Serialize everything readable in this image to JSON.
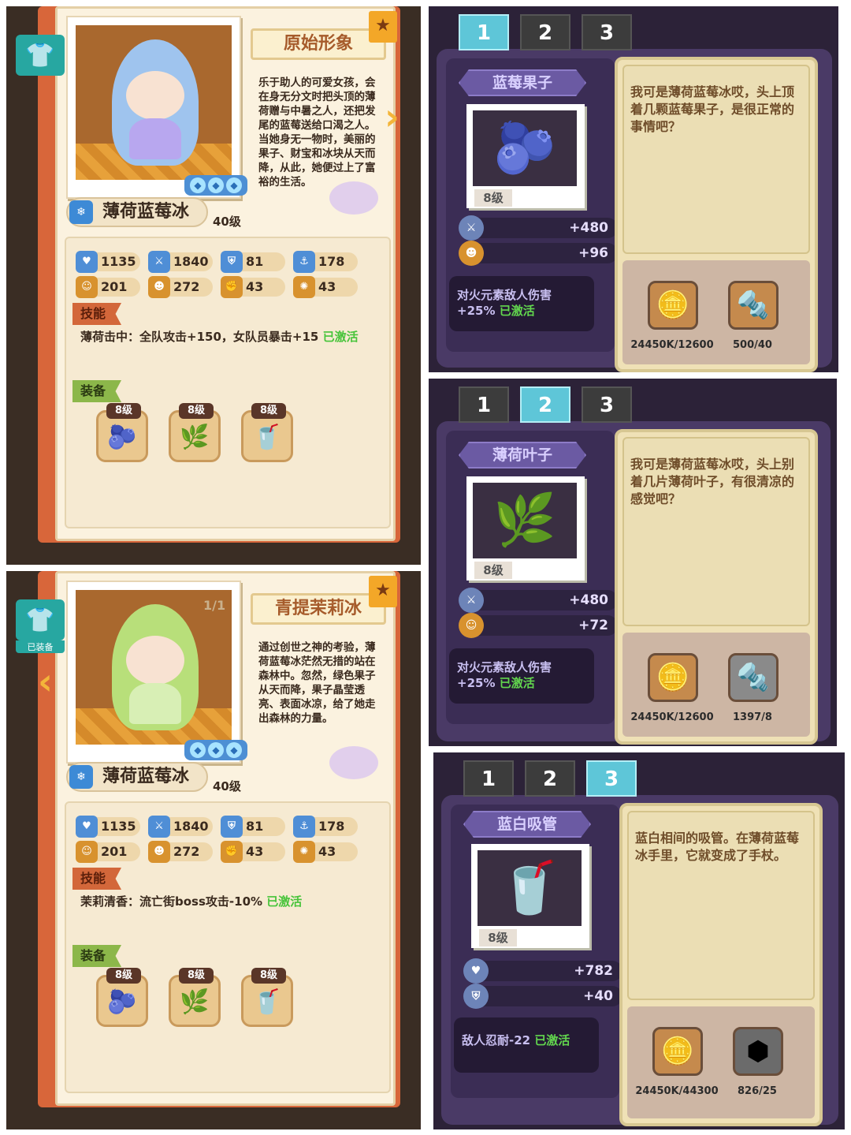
{
  "character_pages": [
    {
      "title": "原始形象",
      "counter": "",
      "description": "乐于助人的可爱女孩，会在身无分文时把头顶的薄荷赠与中暑之人，还把发尾的蓝莓送给口渴之人。当她身无一物时，美丽的果子、财宝和冰块从天而降，从此，她便过上了富裕的生活。",
      "name": "薄荷蓝莓冰",
      "level": "40级",
      "equipped_label": "",
      "stats": [
        "1135",
        "1840",
        "81",
        "178",
        "201",
        "272",
        "43",
        "43"
      ],
      "skill_tag": "技能",
      "skill_text": "薄荷击中：全队攻击+150，女队员暴击+15",
      "skill_status": "已激活",
      "equip_tag": "装备",
      "equip_levels": [
        "8级",
        "8级",
        "8级"
      ],
      "arrow": "›"
    },
    {
      "title": "青提茉莉冰",
      "counter": "1/1",
      "description": "通过创世之神的考验，薄荷蓝莓冰茫然无措的站在森林中。忽然，绿色果子从天而降，果子晶莹透亮、表面冰凉，给了她走出森林的力量。",
      "name": "薄荷蓝莓冰",
      "level": "40级",
      "equipped_label": "已装备",
      "stats": [
        "1135",
        "1840",
        "81",
        "178",
        "201",
        "272",
        "43",
        "43"
      ],
      "skill_tag": "技能",
      "skill_text": "茉莉清香：流亡街boss攻击-10%",
      "skill_status": "已激活",
      "equip_tag": "装备",
      "equip_levels": [
        "8级",
        "8级",
        "8级"
      ],
      "arrow": "‹"
    }
  ],
  "item_pages": [
    {
      "tabs": [
        "1",
        "2",
        "3"
      ],
      "active_tab": 0,
      "name": "蓝莓果子",
      "level": "8级",
      "bonus1": "+480",
      "bonus2": "+96",
      "effect_text": "对火元素敌人伤害+25%",
      "effect_status": "已激活",
      "description": "我可是薄荷蓝莓冰哎，头上顶着几颗蓝莓果子，是很正常的事情吧？",
      "mat1": "24450K/12600",
      "mat2": "500/40"
    },
    {
      "tabs": [
        "1",
        "2",
        "3"
      ],
      "active_tab": 1,
      "name": "薄荷叶子",
      "level": "8级",
      "bonus1": "+480",
      "bonus2": "+72",
      "effect_text": "对火元素敌人伤害+25%",
      "effect_status": "已激活",
      "description": "我可是薄荷蓝莓冰哎，头上别着几片薄荷叶子，有很清凉的感觉吧？",
      "mat1": "24450K/12600",
      "mat2": "1397/8"
    },
    {
      "tabs": [
        "1",
        "2",
        "3"
      ],
      "active_tab": 2,
      "name": "蓝白吸管",
      "level": "8级",
      "bonus1": "+782",
      "bonus2": "+40",
      "effect_text": "敌人忍耐-22",
      "effect_status": "已激活",
      "description": "蓝白相间的吸管。在薄荷蓝莓冰手里，它就变成了手杖。",
      "mat1": "24450K/44300",
      "mat2": "826/25"
    }
  ],
  "colors": {
    "accent_green": "#47c43a",
    "tab_active": "#5ec6d8",
    "item_bg": "#4a3a66"
  }
}
